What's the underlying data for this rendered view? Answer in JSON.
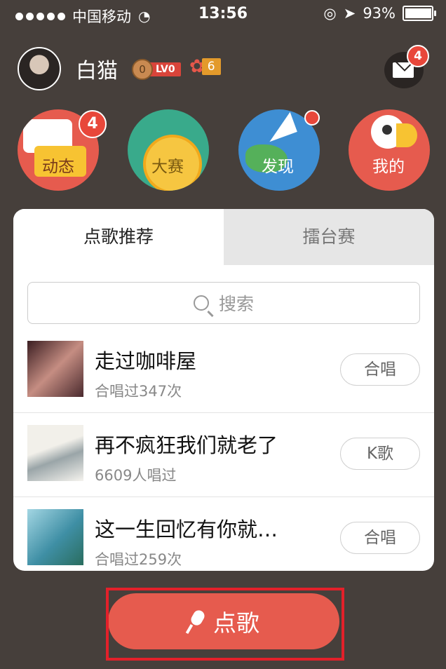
{
  "status_bar": {
    "carrier": "中国移动",
    "time": "13:56",
    "battery": "93%",
    "battery_level": 0.93
  },
  "user": {
    "name": "白猫",
    "coin_count": "0",
    "level": "LV0",
    "flowers": "6",
    "mail_badge": "4"
  },
  "categories": [
    {
      "label": "动态",
      "badge": "4",
      "icon": "chat-bubble-icon"
    },
    {
      "label": "大赛",
      "icon": "medal-icon"
    },
    {
      "label": "发现",
      "icon": "paper-plane-globe-icon",
      "dot": true
    },
    {
      "label": "我的",
      "icon": "bird-icon"
    }
  ],
  "tabs": [
    {
      "label": "点歌推荐",
      "active": true
    },
    {
      "label": "擂台赛",
      "active": false
    }
  ],
  "search": {
    "placeholder": "搜索"
  },
  "songs": [
    {
      "title": "走过咖啡屋",
      "meta": "合唱过347次",
      "action": "合唱"
    },
    {
      "title": "再不疯狂我们就老了",
      "meta": "6609人唱过",
      "action": "K歌"
    },
    {
      "title": "这一生回忆有你就…",
      "meta": "合唱过259次",
      "action": "合唱"
    }
  ],
  "primary_action": {
    "label": "点歌"
  },
  "colors": {
    "background": "#463f3b",
    "accent": "#e65b4e",
    "badge": "#e8473a"
  }
}
